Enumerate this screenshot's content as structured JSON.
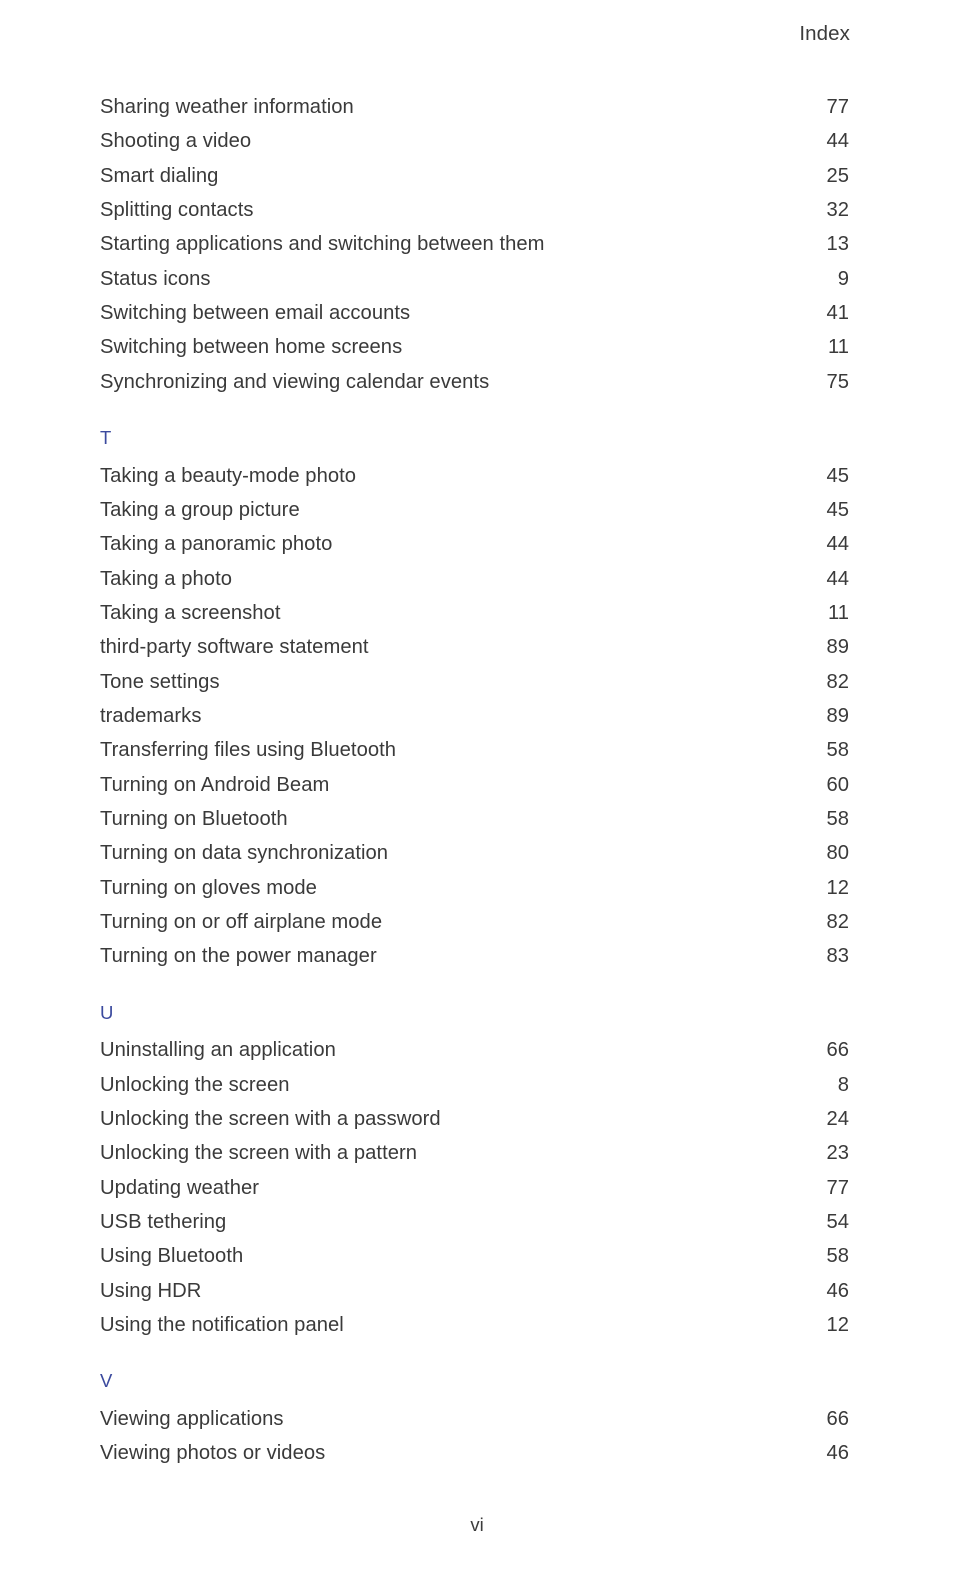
{
  "page": {
    "running_head": "Index",
    "folio": "vi",
    "heading_color": "#3b4a9e",
    "text_color": "#3a3a3a"
  },
  "sections": [
    {
      "letter": "",
      "show_letter": false,
      "entries": [
        {
          "title": "Sharing weather information",
          "page": "77"
        },
        {
          "title": "Shooting a video",
          "page": "44"
        },
        {
          "title": "Smart dialing",
          "page": "25"
        },
        {
          "title": "Splitting contacts",
          "page": "32"
        },
        {
          "title": "Starting applications and switching between them",
          "page": "13"
        },
        {
          "title": "Status icons",
          "page": "9"
        },
        {
          "title": "Switching between email accounts",
          "page": "41"
        },
        {
          "title": "Switching between home screens",
          "page": "11"
        },
        {
          "title": "Synchronizing and viewing calendar events",
          "page": "75"
        }
      ]
    },
    {
      "letter": "T",
      "show_letter": true,
      "entries": [
        {
          "title": "Taking a beauty-mode photo",
          "page": "45"
        },
        {
          "title": "Taking a group picture",
          "page": "45"
        },
        {
          "title": "Taking a panoramic photo",
          "page": "44"
        },
        {
          "title": "Taking a photo",
          "page": "44"
        },
        {
          "title": "Taking a screenshot",
          "page": "11"
        },
        {
          "title": "third-party software statement",
          "page": "89"
        },
        {
          "title": "Tone settings",
          "page": "82"
        },
        {
          "title": "trademarks",
          "page": "89"
        },
        {
          "title": "Transferring files using Bluetooth",
          "page": "58"
        },
        {
          "title": "Turning on Android Beam",
          "page": "60"
        },
        {
          "title": "Turning on Bluetooth",
          "page": "58"
        },
        {
          "title": "Turning on data synchronization",
          "page": "80"
        },
        {
          "title": "Turning on gloves mode",
          "page": "12"
        },
        {
          "title": "Turning on or off airplane mode",
          "page": "82"
        },
        {
          "title": "Turning on the power manager",
          "page": "83"
        }
      ]
    },
    {
      "letter": "U",
      "show_letter": true,
      "entries": [
        {
          "title": "Uninstalling an application",
          "page": "66"
        },
        {
          "title": "Unlocking the screen",
          "page": "8"
        },
        {
          "title": "Unlocking the screen with a password",
          "page": "24"
        },
        {
          "title": "Unlocking the screen with a pattern",
          "page": "23"
        },
        {
          "title": "Updating weather",
          "page": "77"
        },
        {
          "title": "USB tethering",
          "page": "54"
        },
        {
          "title": "Using Bluetooth",
          "page": "58"
        },
        {
          "title": "Using HDR",
          "page": "46"
        },
        {
          "title": "Using the notification panel",
          "page": "12"
        }
      ]
    },
    {
      "letter": "V",
      "show_letter": true,
      "entries": [
        {
          "title": "Viewing applications",
          "page": "66"
        },
        {
          "title": "Viewing photos or videos",
          "page": "46"
        }
      ]
    }
  ]
}
